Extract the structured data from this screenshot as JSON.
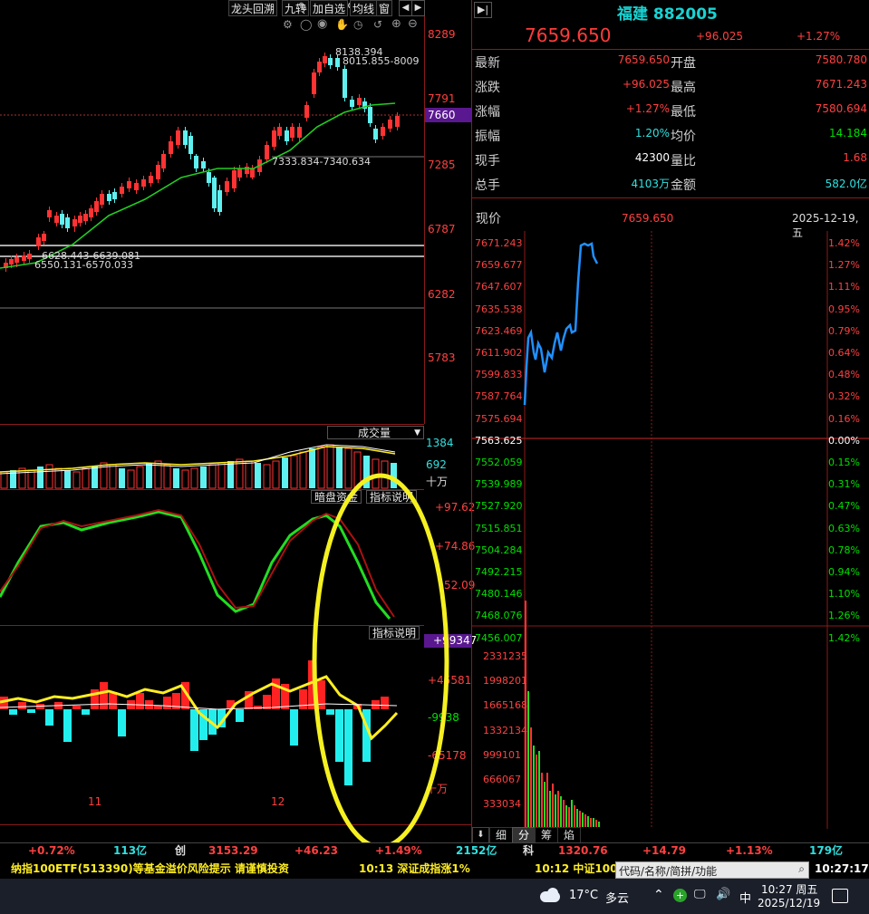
{
  "toolbar": {
    "btn1": "龙头回溯",
    "btn2": "九转",
    "btn3": "加自选",
    "btn4": "均线",
    "btn5": "窗"
  },
  "kline": {
    "ylabels": [
      "8289",
      "7791",
      "7285",
      "6787",
      "6282",
      "5783"
    ],
    "current_price_tag": "7660",
    "annot_high1": "8138.394",
    "annot_high2": "8015.855-8009",
    "annot_mid": "7333.834-7340.634",
    "annot_low1": "6628.443-6639.081",
    "annot_low2": "6550.131-6570.033"
  },
  "volume": {
    "title": "成交量",
    "labels": [
      "1384",
      "692"
    ],
    "unit": "十万"
  },
  "indicator1": {
    "btn_a": "暗盘资金",
    "btn_b": "指标说明",
    "labels": [
      "+97.62",
      "+74.86",
      "52.09"
    ]
  },
  "indicator2": {
    "btn": "指标说明",
    "tag": "+99347",
    "labels": [
      "+45581",
      "-9938",
      "-65178"
    ],
    "unit": "十万"
  },
  "dates": {
    "d1": "11",
    "d2": "12"
  },
  "quote": {
    "name": "福建 882005",
    "price": "7659.650",
    "change": "+96.025",
    "pct": "+1.27%",
    "rows": [
      {
        "l1": "最新",
        "v1": "7659.650",
        "l2": "开盘",
        "v2": "7580.780",
        "c1": "red",
        "c2": "red"
      },
      {
        "l1": "涨跌",
        "v1": "+96.025",
        "l2": "最高",
        "v2": "7671.243",
        "c1": "red",
        "c2": "red"
      },
      {
        "l1": "涨幅",
        "v1": "+1.27%",
        "l2": "最低",
        "v2": "7580.694",
        "c1": "red",
        "c2": "red"
      },
      {
        "l1": "振幅",
        "v1": "1.20%",
        "l2": "均价",
        "v2": "14.184",
        "c1": "cyan",
        "c2": "green"
      },
      {
        "l1": "现手",
        "v1": "42300",
        "l2": "量比",
        "v2": "1.68",
        "c1": "white",
        "c2": "red"
      },
      {
        "l1": "总手",
        "v1": "4103万",
        "l2": "金额",
        "v2": "582.0亿",
        "c1": "cyan",
        "c2": "cyan"
      }
    ]
  },
  "intraday": {
    "label": "现价",
    "price": "7659.650",
    "date": "2025-12-19,五",
    "left_axis": [
      "7671.243",
      "7659.677",
      "7647.607",
      "7635.538",
      "7623.469",
      "7611.902",
      "7599.833",
      "7587.764",
      "7575.694",
      "7563.625",
      "7552.059",
      "7539.989",
      "7527.920",
      "7515.851",
      "7504.284",
      "7492.215",
      "7480.146",
      "7468.076",
      "7456.007"
    ],
    "right_axis": [
      "1.42%",
      "1.27%",
      "1.11%",
      "0.95%",
      "0.79%",
      "0.64%",
      "0.48%",
      "0.32%",
      "0.16%",
      "0.00%",
      "0.15%",
      "0.31%",
      "0.47%",
      "0.63%",
      "0.78%",
      "0.94%",
      "1.10%",
      "1.26%",
      "1.42%"
    ],
    "vol_axis": [
      "2331235",
      "1998201",
      "1665168",
      "1332134",
      "999101",
      "666067",
      "333034"
    ],
    "tabs": [
      "细",
      "分",
      "筹",
      "焰"
    ]
  },
  "statusbar": {
    "s1": "+0.72%",
    "s2": "113亿",
    "s3": "创",
    "s4": "3153.29",
    "s5": "+46.23",
    "s6": "+1.49%",
    "s7": "2152亿",
    "s8": "科",
    "s9": "1320.76",
    "s10": "+14.79",
    "s11": "+1.13%",
    "s12": "179亿"
  },
  "ticker": {
    "t1": "纳指100ETF(513390)等基金溢价风险提示 请谨慎投资",
    "t2": "10:13 深证成指涨1%",
    "t3": "10:12 中证100",
    "search_placeholder": "代码/名称/简拼/功能",
    "clock": "10:27:17"
  },
  "taskbar": {
    "weather": "17°C",
    "weather_desc": "多云",
    "ime": "中",
    "time": "10:27 周五",
    "date": "2025/12/19"
  }
}
